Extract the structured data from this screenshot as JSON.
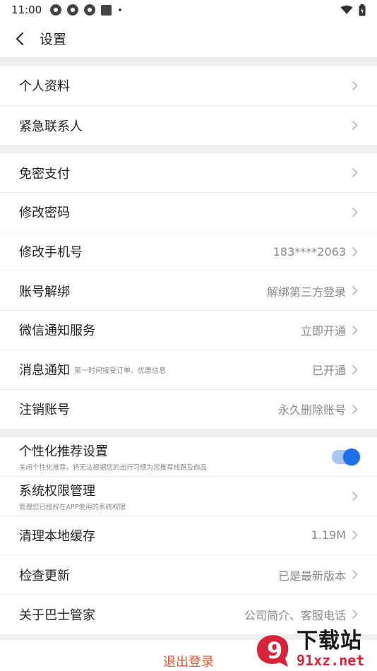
{
  "status_bar": {
    "time": "11:00"
  },
  "nav": {
    "title": "设置"
  },
  "group1": [
    {
      "label": "个人资料"
    },
    {
      "label": "紧急联系人"
    }
  ],
  "group2": [
    {
      "label": "免密支付",
      "value": ""
    },
    {
      "label": "修改密码",
      "value": ""
    },
    {
      "label": "修改手机号",
      "value": "183****2063"
    },
    {
      "label": "账号解绑",
      "value": "解绑第三方登录"
    },
    {
      "label": "微信通知服务",
      "value": "立即开通"
    },
    {
      "label": "消息通知",
      "sub": "第一时间接受订单、优惠信息",
      "value": "已开通"
    },
    {
      "label": "注销账号",
      "value": "永久删除账号"
    }
  ],
  "group3": {
    "personalized": {
      "label": "个性化推荐设置",
      "desc": "关闭个性化推荐，将无法根据您的出行习惯为您推荐线路及商品",
      "enabled": true
    },
    "permissions": {
      "label": "系统权限管理",
      "desc": "管理您已授权在APP使用的系统权限"
    },
    "cache": {
      "label": "清理本地缓存",
      "value": "1.19M"
    },
    "update": {
      "label": "检查更新",
      "value": "已是最新版本"
    },
    "about": {
      "label": "关于巴士管家",
      "value": "公司简介、客服电话"
    }
  },
  "logout": {
    "label": "退出登录"
  },
  "watermark": {
    "cn": "下载站",
    "en": "91xz.net",
    "badge_number": "9"
  },
  "colors": {
    "accent": "#1f6fe8",
    "danger": "#ea5a2e",
    "watermark_red": "#d8243a"
  }
}
